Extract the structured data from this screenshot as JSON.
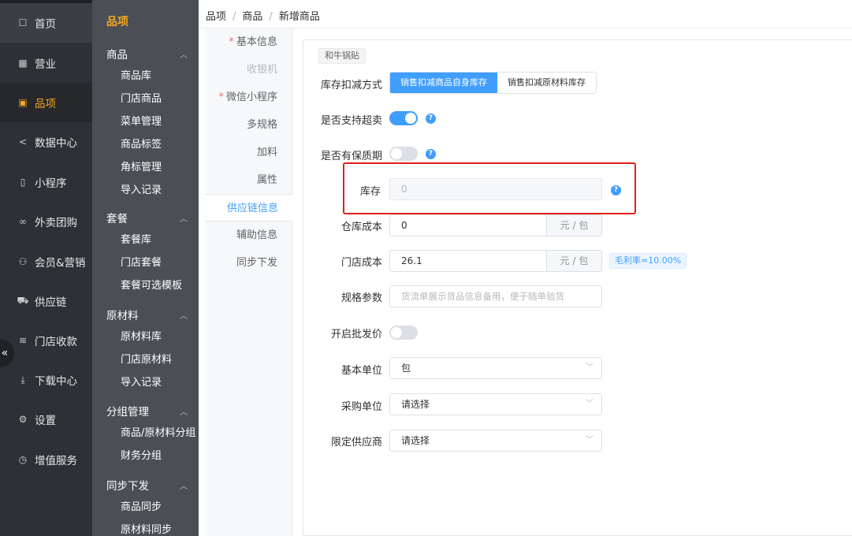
{
  "nav1": {
    "items": [
      {
        "label": "首页",
        "icon": "home-icon"
      },
      {
        "label": "营业",
        "icon": "calendar-icon"
      },
      {
        "label": "品项",
        "icon": "bag-icon"
      },
      {
        "label": "数据中心",
        "icon": "share-icon"
      },
      {
        "label": "小程序",
        "icon": "phone-icon"
      },
      {
        "label": "外卖团购",
        "icon": "bike-icon"
      },
      {
        "label": "会员&营销",
        "icon": "user-icon"
      },
      {
        "label": "供应链",
        "icon": "truck-icon"
      },
      {
        "label": "门店收款",
        "icon": "database-icon"
      },
      {
        "label": "下载中心",
        "icon": "download-icon"
      },
      {
        "label": "设置",
        "icon": "gear-icon"
      },
      {
        "label": "增值服务",
        "icon": "clock-icon"
      }
    ],
    "collapse_glyph": "«"
  },
  "nav2": {
    "title": "品项",
    "groups": [
      {
        "label": "商品",
        "items": [
          "商品库",
          "门店商品",
          "菜单管理",
          "商品标签",
          "角标管理",
          "导入记录"
        ]
      },
      {
        "label": "套餐",
        "items": [
          "套餐库",
          "门店套餐",
          "套餐可选模板"
        ]
      },
      {
        "label": "原材料",
        "items": [
          "原材料库",
          "门店原材料",
          "导入记录"
        ]
      },
      {
        "label": "分组管理",
        "items": [
          "商品/原材料分组",
          "财务分组"
        ]
      },
      {
        "label": "同步下发",
        "items": [
          "商品同步",
          "原材料同步"
        ]
      }
    ]
  },
  "breadcrumb": [
    "品项",
    "商品",
    "新增商品"
  ],
  "breadcrumb_sep": "/",
  "side_tabs": [
    {
      "label": "基本信息",
      "required": true,
      "state": "normal"
    },
    {
      "label": "收银机",
      "required": false,
      "state": "disabled"
    },
    {
      "label": "微信小程序",
      "required": true,
      "state": "normal"
    },
    {
      "label": "多规格",
      "required": false,
      "state": "normal"
    },
    {
      "label": "加料",
      "required": false,
      "state": "normal"
    },
    {
      "label": "属性",
      "required": false,
      "state": "normal"
    },
    {
      "label": "供应链信息",
      "required": false,
      "state": "active"
    },
    {
      "label": "辅助信息",
      "required": false,
      "state": "normal"
    },
    {
      "label": "同步下发",
      "required": false,
      "state": "normal"
    }
  ],
  "required_mark": "*",
  "form": {
    "product_tag": "和牛锅贴",
    "stock_deduct": {
      "label": "库存扣减方式",
      "options": [
        "销售扣减商品自身库存",
        "销售扣减原材料库存"
      ],
      "selected": 0
    },
    "oversell": {
      "label": "是否支持超卖",
      "on": true
    },
    "shelf_life": {
      "label": "是否有保质期",
      "on": false
    },
    "stock": {
      "label": "库存",
      "value": "0"
    },
    "warehouse_cost": {
      "label": "仓库成本",
      "value": "0",
      "unit": "元 / 包"
    },
    "store_cost": {
      "label": "门店成本",
      "value": "26.1",
      "unit": "元 / 包",
      "margin": "毛利率≈10.00%"
    },
    "spec_params": {
      "label": "规格参数",
      "placeholder": "货流单展示货品信息备用，便于随单验货"
    },
    "wholesale": {
      "label": "开启批发价",
      "on": false
    },
    "base_unit": {
      "label": "基本单位",
      "value": "包"
    },
    "purchase_unit": {
      "label": "采购单位",
      "value": "请选择"
    },
    "supplier": {
      "label": "限定供应商",
      "value": "请选择"
    },
    "help_glyph": "?",
    "select_arrow": "﹀"
  },
  "colors": {
    "accent": "#409eff",
    "nav_active": "#f5a623",
    "highlight_box": "#e02020"
  }
}
